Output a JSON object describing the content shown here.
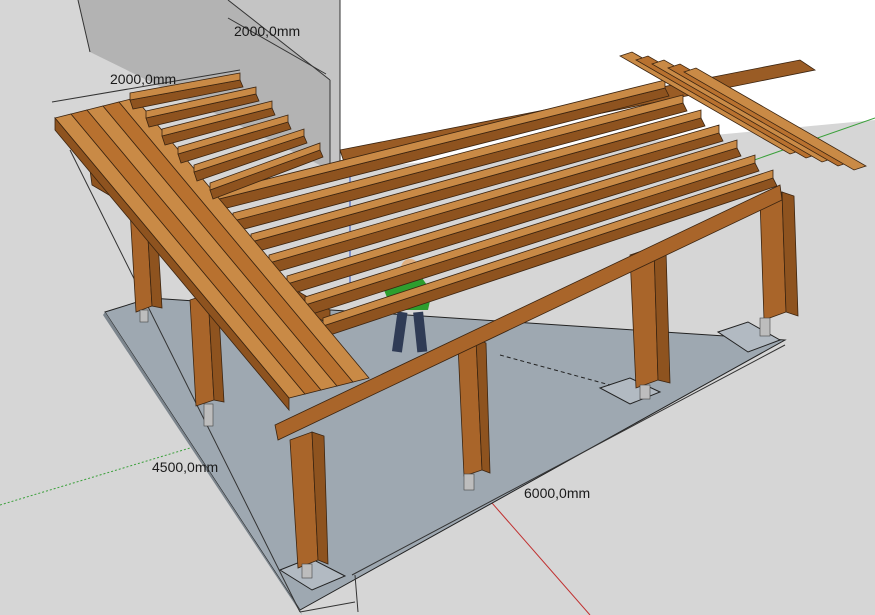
{
  "dimensions": {
    "top_upper": "2000,0mm",
    "top_left": "2000,0mm",
    "left": "4500,0mm",
    "bottom": "6000,0mm"
  },
  "colors": {
    "sky_bg": "#d9d9d9",
    "ground": "#d2d2d2",
    "wall": "#b4b4b4",
    "wall_light": "#f2f2f2",
    "slab": "#9ba5ae",
    "wood": "#b8712f",
    "wood_dark": "#8e531f",
    "wood_light": "#c98a46",
    "steel": "#b8b8b8",
    "axis_red": "#c03030",
    "axis_green": "#3aa03a",
    "person_shirt": "#2e9e2e",
    "person_pants": "#2f3b55"
  },
  "scene": {
    "objects": [
      "wall",
      "concrete-slab",
      "l-shaped-pergola",
      "posts",
      "beams",
      "rafters",
      "deck-boards",
      "person-figure",
      "axis-lines",
      "dimension-lines"
    ]
  }
}
